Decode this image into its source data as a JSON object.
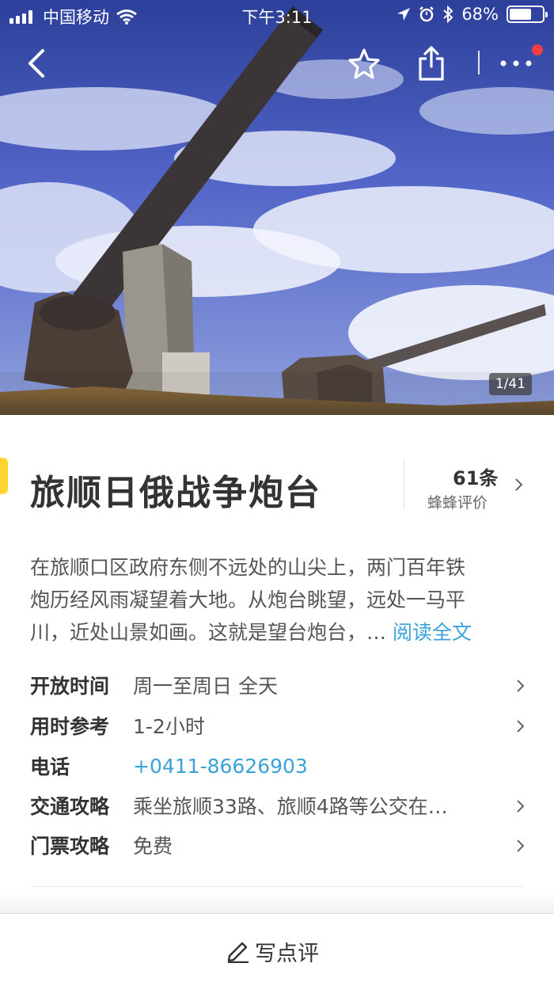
{
  "status_bar": {
    "carrier": "中国移动",
    "time": "下午3:11",
    "battery": "68%",
    "battery_level": 0.68
  },
  "nav": {
    "back_icon": "chevron-left-icon",
    "favorite_icon": "star-icon",
    "share_icon": "share-icon",
    "more_icon": "more-dots-icon",
    "has_notification": true
  },
  "hero": {
    "counter": "1/41"
  },
  "poi": {
    "title": "旅顺日俄战争炮台",
    "review_count": "61条",
    "review_label": "蜂蜂评价"
  },
  "description": {
    "lines": [
      "在旅顺口区政府东侧不远处的山尖上，两门百年铁",
      "炮历经风雨凝望着大地。从炮台眺望，远处一马平",
      "川，近处山景如画。这就是望台炮台，… "
    ],
    "read_more": "阅读全文"
  },
  "info": [
    {
      "label": "开放时间",
      "value": "周一至周日 全天",
      "link": false,
      "chevron": true
    },
    {
      "label": "用时参考",
      "value": "1-2小时",
      "link": false,
      "chevron": true
    },
    {
      "label": "电话",
      "value": "+0411-86626903",
      "link": true,
      "chevron": false
    },
    {
      "label": "交通攻略",
      "value": "乘坐旅顺33路、旅顺4路等公交在…",
      "link": false,
      "chevron": true
    },
    {
      "label": "门票攻略",
      "value": "免费",
      "link": false,
      "chevron": true
    }
  ],
  "bottom_bar": {
    "write_review": "写点评"
  },
  "colors": {
    "accent": "#ffd52e",
    "link": "#3aa2d8",
    "notification": "#f23f3f"
  }
}
